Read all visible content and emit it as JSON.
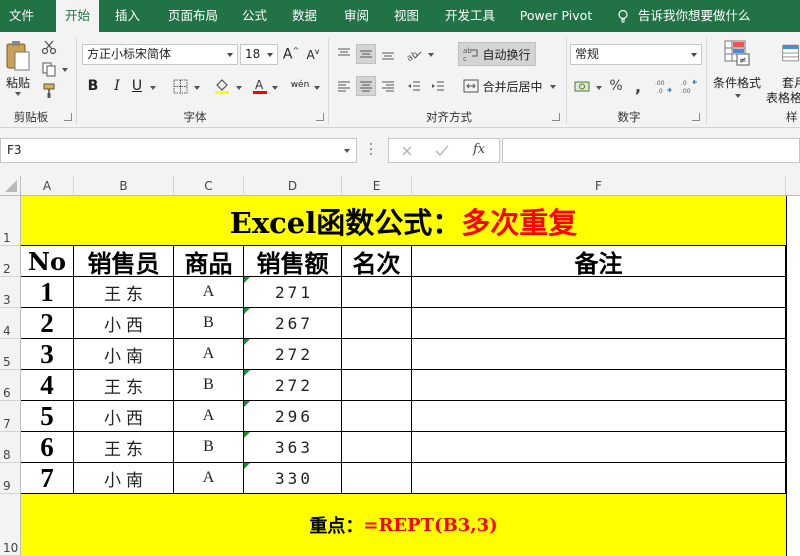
{
  "tabs": [
    "文件",
    "开始",
    "插入",
    "页面布局",
    "公式",
    "数据",
    "审阅",
    "视图",
    "开发工具",
    "Power Pivot"
  ],
  "active_tab": "开始",
  "tell_me": "告诉我你想要做什么",
  "ribbon": {
    "clipboard": {
      "paste_label": "粘贴",
      "group_label": "剪贴板"
    },
    "font": {
      "font_name": "方正小标宋简体",
      "font_size": "18",
      "group_label": "字体"
    },
    "alignment": {
      "wrap_text": "自动换行",
      "merge_center": "合并后居中",
      "group_label": "对齐方式"
    },
    "number": {
      "format": "常规",
      "group_label": "数字"
    },
    "styles": {
      "conditional": "条件格式",
      "table_label_1": "套月",
      "table_label_2": "表格格"
    },
    "styles_group_label": "样"
  },
  "name_box": "F3",
  "fx_label": "fx",
  "columns": [
    "A",
    "B",
    "C",
    "D",
    "E",
    "F"
  ],
  "rows": [
    "1",
    "2",
    "3",
    "4",
    "5",
    "6",
    "7",
    "8",
    "9",
    "10"
  ],
  "sheet": {
    "title_black": "Excel函数公式：",
    "title_red": "多次重复",
    "headers": [
      "No",
      "销售员",
      "商品",
      "销售额",
      "名次",
      "备注"
    ],
    "data": [
      {
        "no": "1",
        "name": "王东",
        "product": "A",
        "amount": "271"
      },
      {
        "no": "2",
        "name": "小西",
        "product": "B",
        "amount": "267"
      },
      {
        "no": "3",
        "name": "小南",
        "product": "A",
        "amount": "272"
      },
      {
        "no": "4",
        "name": "王东",
        "product": "B",
        "amount": "272"
      },
      {
        "no": "5",
        "name": "小西",
        "product": "A",
        "amount": "296"
      },
      {
        "no": "6",
        "name": "王东",
        "product": "B",
        "amount": "363"
      },
      {
        "no": "7",
        "name": "小南",
        "product": "A",
        "amount": "330"
      }
    ],
    "note_black": "重点：",
    "note_red": "=REPT(B3,3)"
  },
  "colors": {
    "excel_green": "#217346",
    "highlight": "#ffff00",
    "title_red": "#ff0000",
    "note_red": "#ff0000"
  }
}
